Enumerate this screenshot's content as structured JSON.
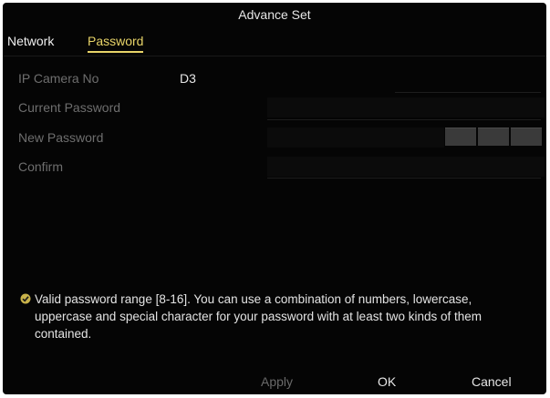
{
  "dialog": {
    "title": "Advance Set"
  },
  "tabs": [
    {
      "label": "Network",
      "active": false
    },
    {
      "label": "Password",
      "active": true
    }
  ],
  "form": {
    "ip_camera_no_label": "IP Camera No",
    "ip_camera_no_value": "D3",
    "current_password_label": "Current Password",
    "new_password_label": "New Password",
    "confirm_label": "Confirm"
  },
  "hint": {
    "icon": "check-icon",
    "text": "Valid password range [8-16]. You can use a combination of numbers, lowercase, uppercase and special character for your password with at least two kinds of them contained."
  },
  "buttons": {
    "apply": "Apply",
    "ok": "OK",
    "cancel": "Cancel"
  },
  "colors": {
    "background": "#050505",
    "active_tab": "#e8d468",
    "hint_check": "#c8b24a"
  }
}
